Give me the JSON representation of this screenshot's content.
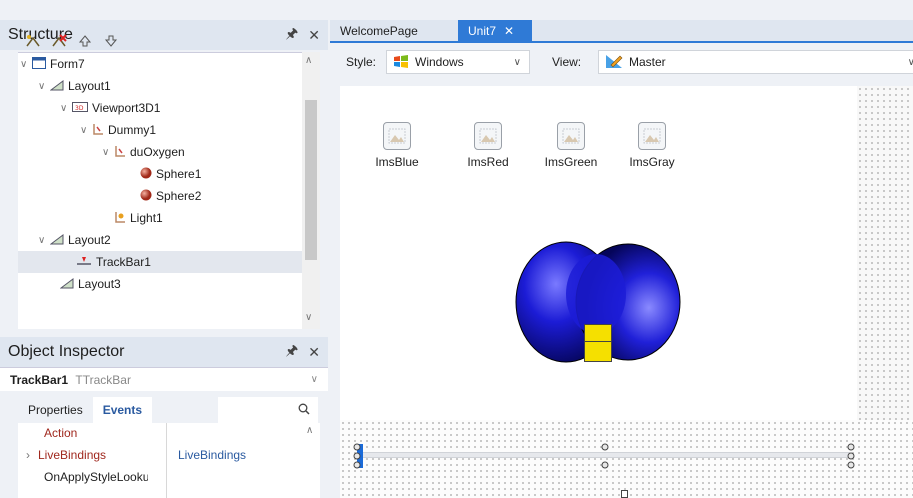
{
  "structure": {
    "title": "Structure",
    "tree": [
      {
        "label": "Form7"
      },
      {
        "label": "Layout1"
      },
      {
        "label": "Viewport3D1"
      },
      {
        "label": "Dummy1"
      },
      {
        "label": "duOxygen"
      },
      {
        "label": "Sphere1"
      },
      {
        "label": "Sphere2"
      },
      {
        "label": "Light1"
      },
      {
        "label": "Layout2"
      },
      {
        "label": "TrackBar1"
      },
      {
        "label": "Layout3"
      }
    ]
  },
  "inspector": {
    "title": "Object Inspector",
    "selected_name": "TrackBar1",
    "selected_type": "TTrackBar",
    "tabs": [
      "Properties",
      "Events"
    ],
    "active_tab": "Events",
    "rows": [
      {
        "name": "Action",
        "value": ""
      },
      {
        "name": "LiveBindings",
        "value": "LiveBindings"
      },
      {
        "name": "OnApplyStyleLookup",
        "value": ""
      }
    ]
  },
  "editor": {
    "tabs": [
      "WelcomePage",
      "Unit7"
    ],
    "active_tab": "Unit7",
    "style_label": "Style:",
    "style_value": "Windows",
    "view_label": "View:",
    "view_value": "Master"
  },
  "components": [
    {
      "label": "ImsBlue"
    },
    {
      "label": "ImsRed"
    },
    {
      "label": "ImsGreen"
    },
    {
      "label": "ImsGray"
    }
  ],
  "colors": {
    "accent": "#2f7ad6",
    "molecule": "#1c1cd6",
    "yellow_box": "#f5e000"
  }
}
